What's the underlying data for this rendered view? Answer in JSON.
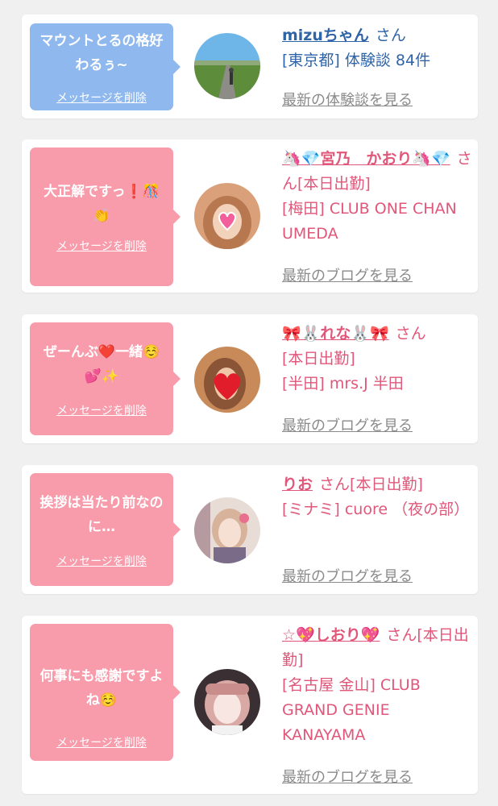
{
  "cards": [
    {
      "message": "マウントとるの格好わるぅ~",
      "delete_label": "メッセージを削除",
      "name": "mizuちゃん",
      "san": "さん",
      "status": "",
      "shop": "[東京都] 体験談 84件",
      "latest_label": "最新の体験談を見る"
    },
    {
      "message": "大正解ですっ❗️🎊👏",
      "delete_label": "メッセージを削除",
      "name": "🦄💎宮乃　かおり🦄💎",
      "san": "さん",
      "status": "[本日出勤]",
      "shop": "[梅田] CLUB ONE CHAN UMEDA",
      "latest_label": "最新のブログを見る"
    },
    {
      "message": "ぜーんぶ❤️一緒☺️💕✨",
      "delete_label": "メッセージを削除",
      "name": "🎀🐰れな🐰🎀",
      "san": "さん",
      "status": "[本日出勤]",
      "shop": "[半田] mrs.J 半田",
      "latest_label": "最新のブログを見る"
    },
    {
      "message": "挨拶は当たり前なのに…",
      "delete_label": "メッセージを削除",
      "name": "りお",
      "san": "さん",
      "status": "[本日出勤]",
      "shop": "[ミナミ] cuore （夜の部）",
      "latest_label": "最新のブログを見る"
    },
    {
      "message": "何事にも感謝ですよね☺️",
      "delete_label": "メッセージを削除",
      "name": "☆💖しおり💖",
      "san": "さん",
      "status": "[本日出勤]",
      "shop": "[名古屋 金山] CLUB GRAND GENIE KANAYAMA",
      "latest_label": "最新のブログを見る"
    }
  ],
  "colors": {
    "bubble_blue": "#8fb8ee",
    "bubble_pink": "#f89bab",
    "name_blue": "#2f64a8",
    "name_pink": "#e0577a",
    "link_gray": "#8a8a8a"
  }
}
